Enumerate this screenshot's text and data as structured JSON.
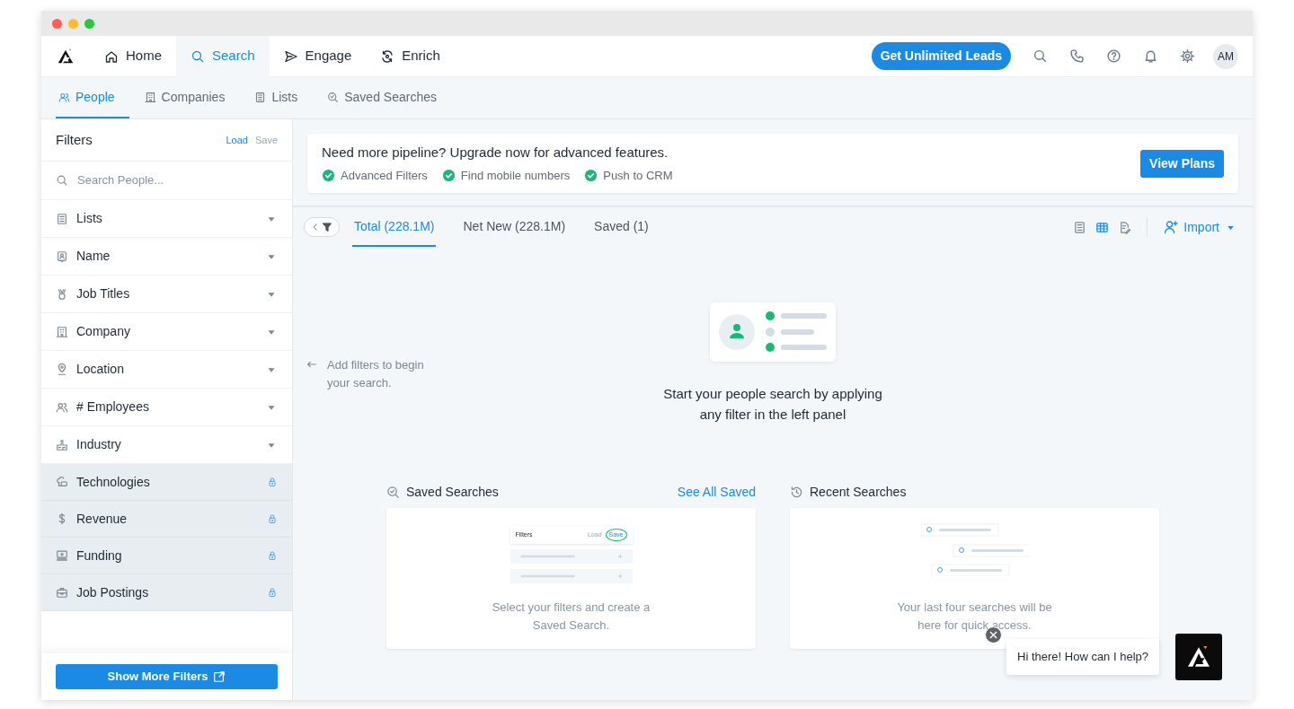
{
  "window": {
    "controls": [
      {
        "color": "#ff5f57"
      },
      {
        "color": "#febc2e"
      },
      {
        "color": "#28c840"
      }
    ]
  },
  "top_nav": {
    "items": [
      {
        "label": "Home",
        "selected": false
      },
      {
        "label": "Search",
        "selected": true
      },
      {
        "label": "Engage",
        "selected": false
      },
      {
        "label": "Enrich",
        "selected": false
      }
    ],
    "cta": "Get Unlimited Leads",
    "avatar": "AM"
  },
  "sub_nav": {
    "items": [
      {
        "label": "People",
        "selected": true
      },
      {
        "label": "Companies",
        "selected": false
      },
      {
        "label": "Lists",
        "selected": false
      },
      {
        "label": "Saved Searches",
        "selected": false
      }
    ]
  },
  "filters": {
    "title": "Filters",
    "load": "Load",
    "save": "Save",
    "search": {
      "placeholder": "Search People..."
    },
    "items": [
      {
        "label": "Lists",
        "locked": false
      },
      {
        "label": "Name",
        "locked": false
      },
      {
        "label": "Job Titles",
        "locked": false
      },
      {
        "label": "Company",
        "locked": false
      },
      {
        "label": "Location",
        "locked": false
      },
      {
        "label": "# Employees",
        "locked": false
      },
      {
        "label": "Industry",
        "locked": false
      },
      {
        "label": "Technologies",
        "locked": true
      },
      {
        "label": "Revenue",
        "locked": true
      },
      {
        "label": "Funding",
        "locked": true
      },
      {
        "label": "Job Postings",
        "locked": true
      }
    ],
    "show_more": "Show More Filters"
  },
  "banner": {
    "title": "Need more pipeline? Upgrade now for advanced features.",
    "features": [
      "Advanced Filters",
      "Find mobile numbers",
      "Push to CRM"
    ],
    "button": "View Plans"
  },
  "results_tabs": [
    {
      "label": "Total (228.1M)",
      "selected": true
    },
    {
      "label": "Net New (228.1M)",
      "selected": false
    },
    {
      "label": "Saved (1)",
      "selected": false
    }
  ],
  "view_modes": [
    {
      "selected": false
    },
    {
      "selected": true
    },
    {
      "selected": false
    }
  ],
  "import": "Import",
  "hint": "Add filters to begin your search.",
  "empty_state": {
    "message": "Start your people search by applying any filter in the left panel"
  },
  "saved_searches": {
    "title": "Saved Searches",
    "link": "See All Saved",
    "mock": {
      "title": "Filters",
      "load": "Load",
      "save": "Save"
    },
    "text": "Select your filters and create a Saved Search."
  },
  "recent_searches": {
    "title": "Recent Searches",
    "text": "Your last four searches will be here for quick access."
  },
  "chat": {
    "message": "Hi there! How can I help?"
  }
}
